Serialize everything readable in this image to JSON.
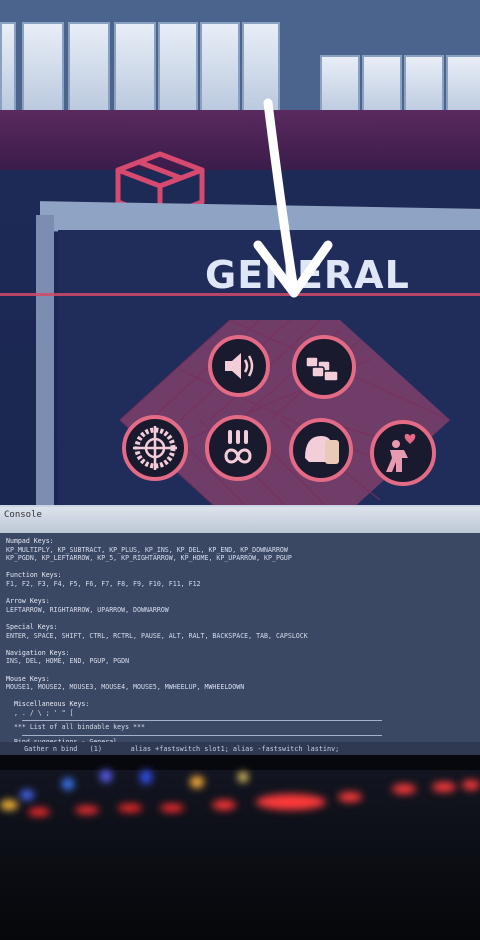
{
  "menu": {
    "title": "GENERAL",
    "icons": [
      {
        "name": "sound-icon"
      },
      {
        "name": "keyboard-icon"
      },
      {
        "name": "crosshair-icon"
      },
      {
        "name": "ammo-infinite-icon"
      },
      {
        "name": "helmet-icon"
      },
      {
        "name": "player-health-icon"
      }
    ],
    "accent_color": "#e46b85"
  },
  "console": {
    "title": "Console",
    "lines": [
      {
        "text": "Numpad Keys:",
        "type": "header"
      },
      {
        "text": "KP_MULTIPLY, KP_SUBTRACT, KP_PLUS, KP_INS, KP_DEL, KP_END, KP_DOWNARROW",
        "type": "line"
      },
      {
        "text": "KP_PGDN, KP_LEFTARROW, KP_5, KP_RIGHTARROW, KP_HOME, KP_UPARROW, KP_PGUP",
        "type": "line"
      },
      {
        "text": "",
        "type": "blank"
      },
      {
        "text": "Function Keys:",
        "type": "header"
      },
      {
        "text": "F1, F2, F3, F4, F5, F6, F7, F8, F9, F10, F11, F12",
        "type": "line"
      },
      {
        "text": "",
        "type": "blank"
      },
      {
        "text": "Arrow Keys:",
        "type": "header"
      },
      {
        "text": "LEFTARROW, RIGHTARROW, UPARROW, DOWNARROW",
        "type": "line"
      },
      {
        "text": "",
        "type": "blank"
      },
      {
        "text": "Special Keys:",
        "type": "header"
      },
      {
        "text": "ENTER, SPACE, SHIFT, CTRL, RCTRL, PAUSE, ALT, RALT, BACKSPACE, TAB, CAPSLOCK",
        "type": "line"
      },
      {
        "text": "",
        "type": "blank"
      },
      {
        "text": "Navigation Keys:",
        "type": "header"
      },
      {
        "text": "INS, DEL, HOME, END, PGUP, PGDN",
        "type": "line"
      },
      {
        "text": "",
        "type": "blank"
      },
      {
        "text": "Mouse Keys:",
        "type": "header"
      },
      {
        "text": "MOUSE1, MOUSE2, MOUSE3, MOUSE4, MOUSE5, MWHEELUP, MWHEELDOWN",
        "type": "line"
      },
      {
        "text": "",
        "type": "blank"
      },
      {
        "text": "  Miscellaneous Keys:",
        "type": "header"
      },
      {
        "text": "  , . / \\ ; ' \" [",
        "type": "line"
      },
      {
        "text": "",
        "type": "sep"
      },
      {
        "text": "  *** List of all bindable keys ***",
        "type": "line"
      },
      {
        "text": "",
        "type": "sep"
      },
      {
        "text": "  Bind suggestions - General",
        "type": "line"
      },
      {
        "text": "",
        "type": "sep"
      }
    ],
    "input_value": "  Gather n bind   (1)       alias +fastswitch slot1; alias -fastswitch lastinv;"
  }
}
